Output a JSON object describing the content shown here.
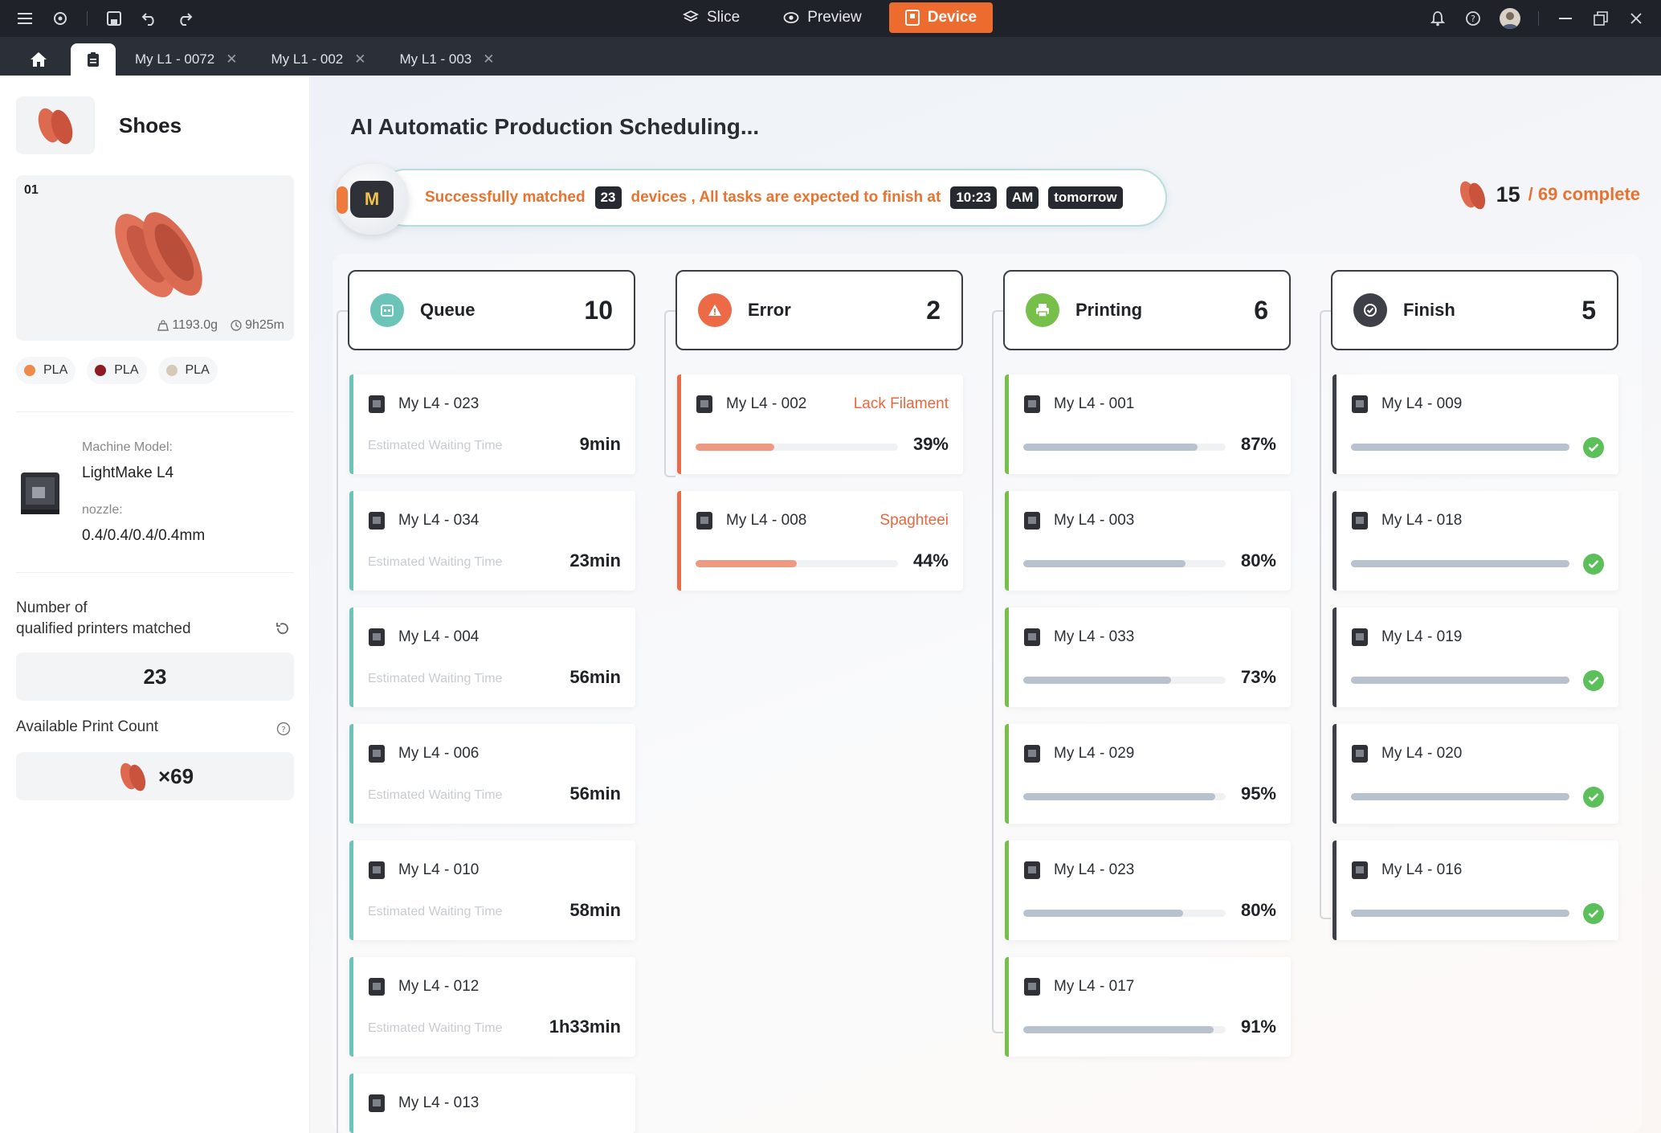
{
  "titlebar": {
    "modes": [
      {
        "label": "Slice",
        "icon": "layers-icon"
      },
      {
        "label": "Preview",
        "icon": "eye-icon"
      },
      {
        "label": "Device",
        "icon": "device-icon",
        "active": true
      }
    ]
  },
  "tabs": [
    {
      "label": "My L1 - 0072"
    },
    {
      "label": "My L1 - 002"
    },
    {
      "label": "My L1 - 003"
    }
  ],
  "sidebar": {
    "product_name": "Shoes",
    "plate_index": "01",
    "weight": "1193.0g",
    "time": "9h25m",
    "filaments": [
      {
        "label": "PLA",
        "color": "#ee8a4a"
      },
      {
        "label": "PLA",
        "color": "#8e1c24"
      },
      {
        "label": "PLA",
        "color": "#d6c9b6"
      }
    ],
    "machine_model_label": "Machine Model:",
    "machine_model": "LightMake L4",
    "nozzle_label": "nozzle:",
    "nozzle": "0.4/0.4/0.4/0.4mm",
    "matched_title_1": "Number of",
    "matched_title_2": "qualified printers matched",
    "matched_count": "23",
    "available_title": "Available Print Count",
    "available_count": "×69"
  },
  "main": {
    "title": "AI Automatic Production Scheduling...",
    "banner": {
      "part1": "Successfully matched",
      "devices": "23",
      "part2": "devices , All tasks are expected to finish at",
      "time": "10:23",
      "ampm": "AM",
      "day": "tomorrow"
    },
    "progress_done": "15",
    "progress_rest": "/ 69 complete",
    "colors": {
      "queue": "#6cc4b8",
      "error": "#ec6a45",
      "printing": "#76c04a",
      "finish": "#3d4046"
    },
    "columns": [
      {
        "label": "Queue",
        "count": "10",
        "cards": [
          {
            "name": "My L4 - 023",
            "wait_label": "Estimated Waiting Time",
            "wait": "9min"
          },
          {
            "name": "My L4 - 034",
            "wait_label": "Estimated Waiting Time",
            "wait": "23min"
          },
          {
            "name": "My L4 - 004",
            "wait_label": "Estimated Waiting Time",
            "wait": "56min"
          },
          {
            "name": "My L4 - 006",
            "wait_label": "Estimated Waiting Time",
            "wait": "56min"
          },
          {
            "name": "My L4 - 010",
            "wait_label": "Estimated Waiting Time",
            "wait": "58min"
          },
          {
            "name": "My L4 - 012",
            "wait_label": "Estimated Waiting Time",
            "wait": "1h33min"
          },
          {
            "name": "My L4 - 013",
            "wait_label": "",
            "wait": ""
          }
        ]
      },
      {
        "label": "Error",
        "count": "2",
        "cards": [
          {
            "name": "My L4 - 002",
            "error": "Lack Filament",
            "pct": "39%",
            "progress": 0.39
          },
          {
            "name": "My L4 - 008",
            "error": "Spaghteei",
            "pct": "44%",
            "progress": 0.5
          }
        ]
      },
      {
        "label": "Printing",
        "count": "6",
        "cards": [
          {
            "name": "My L4 - 001",
            "pct": "87%",
            "progress": 0.86
          },
          {
            "name": "My L4 - 003",
            "pct": "80%",
            "progress": 0.8
          },
          {
            "name": "My L4 - 033",
            "pct": "73%",
            "progress": 0.73
          },
          {
            "name": "My L4 - 029",
            "pct": "95%",
            "progress": 0.95
          },
          {
            "name": "My L4 - 023",
            "pct": "80%",
            "progress": 0.79
          },
          {
            "name": "My L4 - 017",
            "pct": "91%",
            "progress": 0.94
          }
        ]
      },
      {
        "label": "Finish",
        "count": "5",
        "cards": [
          {
            "name": "My L4 - 009"
          },
          {
            "name": "My L4 - 018"
          },
          {
            "name": "My L4 - 019"
          },
          {
            "name": "My L4 - 020"
          },
          {
            "name": "My L4 - 016"
          }
        ]
      }
    ]
  }
}
